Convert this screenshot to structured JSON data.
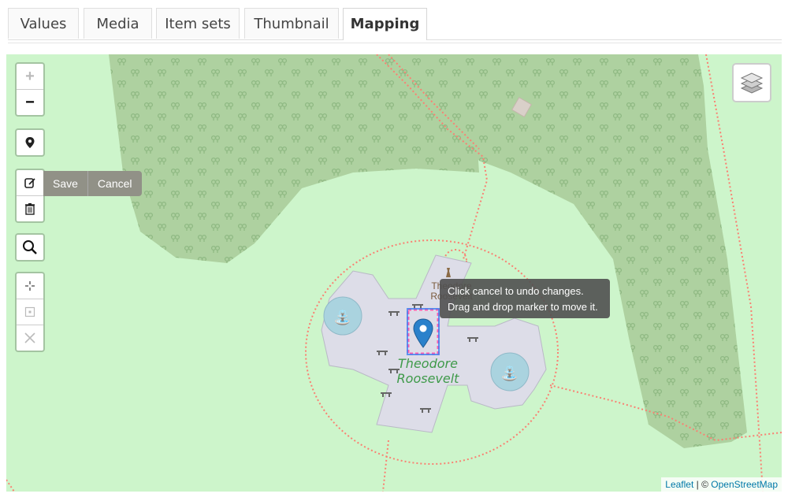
{
  "tabs": [
    {
      "label": "Values"
    },
    {
      "label": "Media"
    },
    {
      "label": "Item sets"
    },
    {
      "label": "Thumbnail"
    },
    {
      "label": "Mapping",
      "active": true
    }
  ],
  "map": {
    "controls": {
      "zoom_in": "+",
      "zoom_out": "−",
      "edit_save": "Save",
      "edit_cancel": "Cancel"
    },
    "tooltip": {
      "line1": "Click cancel to undo changes.",
      "line2": "Drag and drop marker to move it."
    },
    "labels": {
      "park_line1": "Theodore",
      "park_line2": "Roosevelt",
      "poi_line1": "Theodore",
      "poi_line2": "Roosevelt"
    },
    "attribution": {
      "leaflet": "Leaflet",
      "separator": "| ©",
      "osm": "OpenStreetMap"
    },
    "colors": {
      "background": "#cdf5cb",
      "forest": "#aed1a0",
      "pedestrian_area": "#dddde8",
      "fountain": "#aad3df",
      "path": "#fa8072",
      "marker": "#2a81cb"
    }
  }
}
